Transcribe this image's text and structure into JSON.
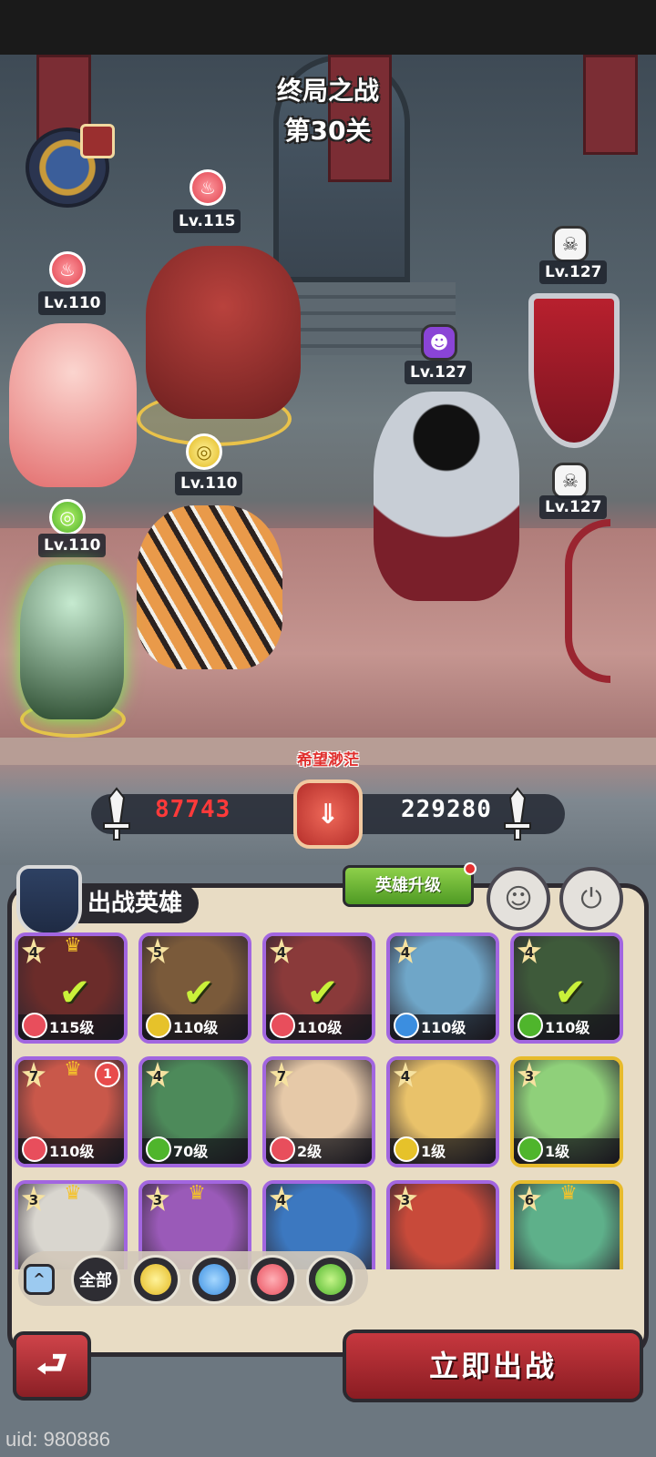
{
  "stage": {
    "line1": "终局之战",
    "line2": "第30关"
  },
  "allies": [
    {
      "name": "minotaur",
      "level": "Lv.115",
      "element": "fire"
    },
    {
      "name": "rose-princess",
      "level": "Lv.110",
      "element": "fire"
    },
    {
      "name": "tiger",
      "level": "Lv.110",
      "element": "earth"
    },
    {
      "name": "dryad",
      "level": "Lv.110",
      "element": "wood"
    }
  ],
  "enemies": [
    {
      "name": "dark-knight",
      "level": "Lv.127",
      "element": "demon"
    },
    {
      "name": "shield-enemy",
      "level": "Lv.127",
      "element": "skull"
    },
    {
      "name": "bow-enemy",
      "level": "Lv.127",
      "element": "skull"
    }
  ],
  "power": {
    "hint": "希望渺茫",
    "ours": "87743",
    "enemy": "229280"
  },
  "panel": {
    "title": "出战英雄",
    "upgrade_label": "英雄升级"
  },
  "heroes": [
    {
      "stars": "4",
      "crown": true,
      "level": "115级",
      "element": "fire",
      "selected": true,
      "tint": "#6b2c2a"
    },
    {
      "stars": "5",
      "crown": false,
      "level": "110级",
      "element": "earth",
      "selected": true,
      "tint": "#7a5a3a"
    },
    {
      "stars": "4",
      "crown": false,
      "level": "110级",
      "element": "fire",
      "selected": true,
      "tint": "#8a3a3a"
    },
    {
      "stars": "4",
      "crown": false,
      "level": "110级",
      "element": "water",
      "selected": false,
      "tint": "#6fa6c8"
    },
    {
      "stars": "4",
      "crown": false,
      "level": "110级",
      "element": "wood",
      "selected": true,
      "tint": "#3e5a3a"
    },
    {
      "stars": "7",
      "crown": true,
      "badge": "1",
      "level": "110级",
      "element": "fire",
      "selected": false,
      "tint": "#c9584a"
    },
    {
      "stars": "4",
      "crown": false,
      "level": "70级",
      "element": "wood",
      "selected": false,
      "tint": "#4d8a5a"
    },
    {
      "stars": "7",
      "crown": false,
      "level": "2级",
      "element": "fire",
      "selected": false,
      "tint": "#e6c9a8"
    },
    {
      "stars": "4",
      "crown": false,
      "level": "1级",
      "element": "earth",
      "selected": false,
      "tint": "#e9c26a"
    },
    {
      "stars": "3",
      "crown": false,
      "level": "1级",
      "element": "wood",
      "selected": false,
      "tint": "#8fd07a"
    },
    {
      "stars": "3",
      "crown": true,
      "level": "",
      "element": "",
      "selected": false,
      "tint": "#d9d6cf"
    },
    {
      "stars": "3",
      "crown": true,
      "level": "",
      "element": "",
      "selected": false,
      "tint": "#9a5ab8"
    },
    {
      "stars": "4",
      "crown": false,
      "level": "",
      "element": "",
      "selected": false,
      "tint": "#3c78c0"
    },
    {
      "stars": "3",
      "crown": false,
      "level": "",
      "element": "",
      "selected": false,
      "tint": "#c84a3a"
    },
    {
      "stars": "6",
      "crown": true,
      "level": "",
      "element": "",
      "selected": false,
      "tint": "#5eb08a"
    }
  ],
  "filters": {
    "all_label": "全部",
    "collapse_icon": "^"
  },
  "actions": {
    "back_icon": "⮐",
    "fight_label": "立即出战"
  },
  "footer": {
    "uid": "uid: 980886"
  },
  "colors": {
    "fire": "#e84e5c",
    "earth": "#e6c22a",
    "water": "#3b8ee0",
    "wood": "#4fb52c"
  }
}
